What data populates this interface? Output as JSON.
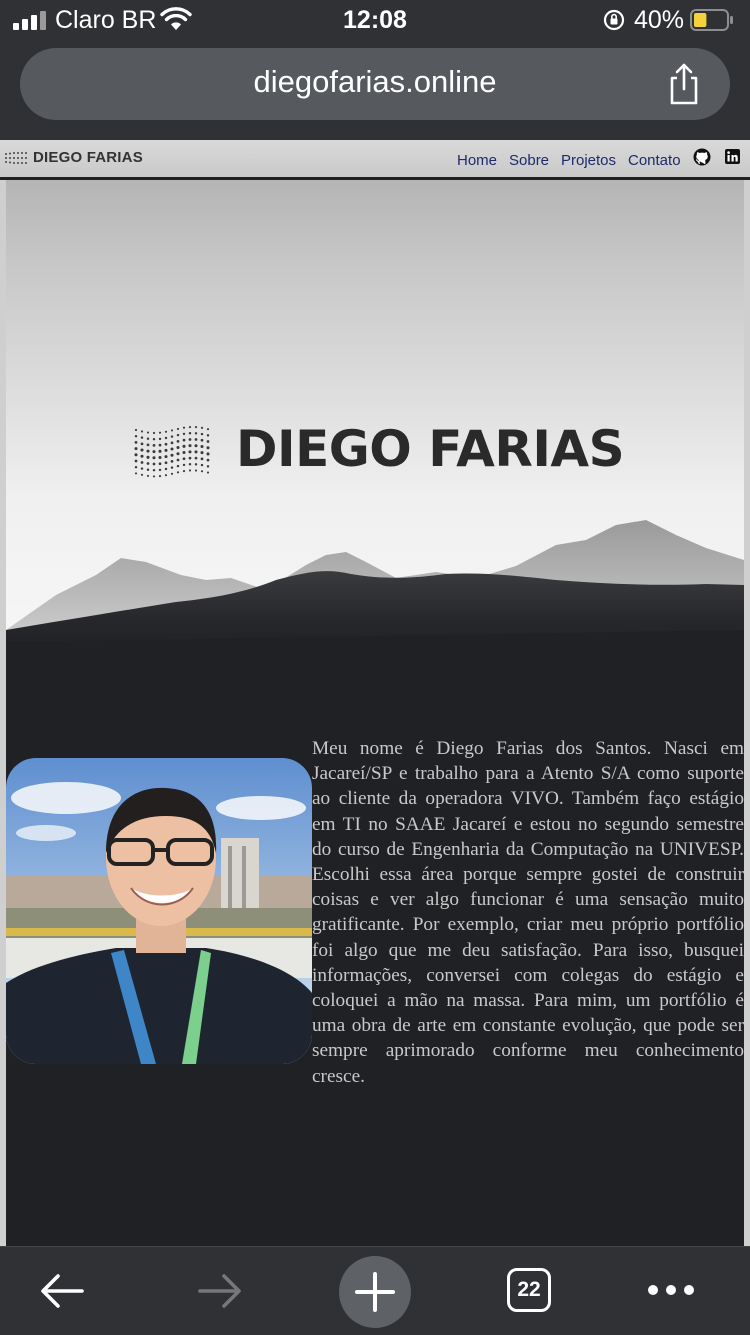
{
  "status_bar": {
    "carrier": "Claro BR",
    "time": "12:08",
    "battery_percent": "40%",
    "battery_level": 0.4,
    "battery_color": "#f5d23c"
  },
  "browser": {
    "url": "diegofarias.online",
    "open_tabs": "22"
  },
  "site": {
    "nav_brand": "DIEGO FARIAS",
    "nav_links": [
      "Home",
      "Sobre",
      "Projetos",
      "Contato"
    ],
    "nav_icons": [
      "github-icon",
      "linkedin-icon"
    ],
    "hero_title": "DIEGO FARIAS",
    "bio": "Meu nome é Diego Farias dos Santos. Nasci em Jacareí/SP e trabalho para a Atento S/A como suporte ao cliente da operadora VIVO. Também faço estágio em TI no SAAE Jacareí e estou no segundo semestre do curso de Engenharia da Computação na UNIVESP. Escolhi essa área porque sempre gostei de construir coisas e ver algo funcionar é uma sensação muito gratificante. Por exemplo, criar meu próprio portfólio foi algo que me deu satisfação. Para isso, busquei informações, conversei com colegas do estágio e coloquei a mão na massa. Para mim, um portfólio é uma obra de arte em constante evolução, que pode ser sempre aprimorado conforme meu conhecimento cresce."
  },
  "colors": {
    "browser_chrome": "#2f3135",
    "url_pill": "#56595e",
    "hero_dark": "#202124",
    "nav_link": "#1f2a6b"
  }
}
